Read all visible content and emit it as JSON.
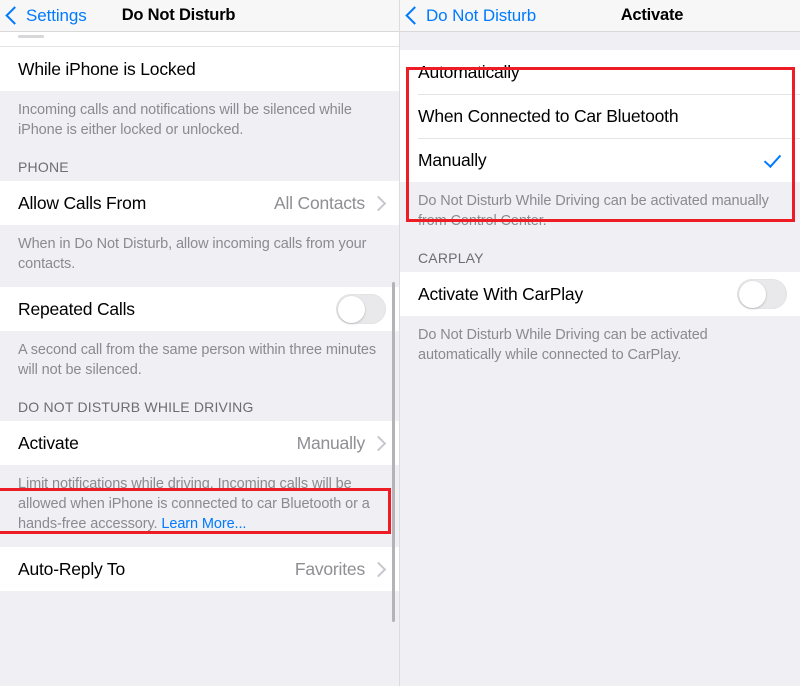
{
  "left_panel": {
    "navbar": {
      "back_label": "Settings",
      "title": "Do Not Disturb"
    },
    "rows": {
      "while_locked_label": "While iPhone is Locked",
      "while_locked_footer": "Incoming calls and notifications will be silenced while iPhone is either locked or unlocked.",
      "phone_header": "PHONE",
      "allow_calls_label": "Allow Calls From",
      "allow_calls_value": "All Contacts",
      "allow_calls_footer": "When in Do Not Disturb, allow incoming calls from your contacts.",
      "repeated_calls_label": "Repeated Calls",
      "repeated_calls_footer": "A second call from the same person within three minutes will not be silenced.",
      "driving_header": "DO NOT DISTURB WHILE DRIVING",
      "activate_label": "Activate",
      "activate_value": "Manually",
      "activate_footer_text": "Limit notifications while driving. Incoming calls will be allowed when iPhone is connected to car Bluetooth or a hands-free accessory. ",
      "activate_footer_link": "Learn More...",
      "auto_reply_label": "Auto-Reply To",
      "auto_reply_value": "Favorites"
    }
  },
  "right_panel": {
    "navbar": {
      "back_label": "Do Not Disturb",
      "title": "Activate"
    },
    "options": [
      {
        "label": "Automatically",
        "selected": false
      },
      {
        "label": "When Connected to Car Bluetooth",
        "selected": false
      },
      {
        "label": "Manually",
        "selected": true
      }
    ],
    "options_footer": "Do Not Disturb While Driving can be activated manually from Control Center.",
    "carplay_header": "CARPLAY",
    "carplay_row_label": "Activate With CarPlay",
    "carplay_footer": "Do Not Disturb While Driving can be activated automatically while connected to CarPlay."
  },
  "colors": {
    "accent_blue": "#007aff",
    "annotation_red": "#ee1c25",
    "secondary_text": "#8e8e93",
    "group_background": "#efeff4"
  }
}
